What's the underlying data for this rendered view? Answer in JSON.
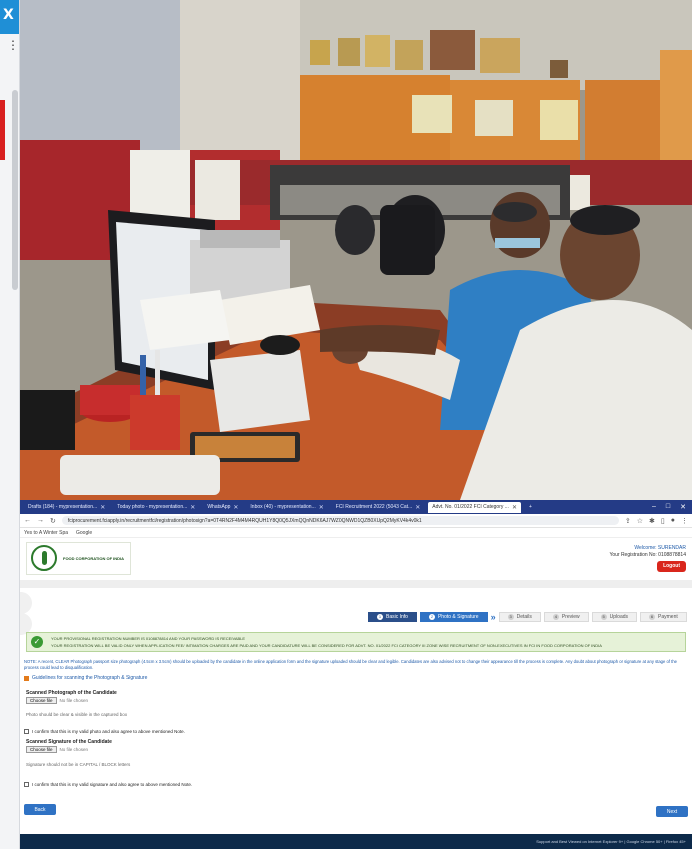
{
  "left_panel": {
    "close_glyph": "X",
    "menu_glyph": "⋮"
  },
  "photo": {
    "description_icon": "photo-image"
  },
  "browser": {
    "tabs": [
      {
        "label": "Drafts (184) - mypresentation...",
        "active": false
      },
      {
        "label": "Today photo - mypresentation...",
        "active": false
      },
      {
        "label": "WhatsApp",
        "active": false
      },
      {
        "label": "Inbox (40) - mypresentation...",
        "active": false
      },
      {
        "label": "FCI Recruitment 2022 (5043 Cat...",
        "active": false
      },
      {
        "label": "Advt. No. 01/2022 FCI Category ...",
        "active": true
      }
    ],
    "new_tab": "+",
    "window_controls": [
      "–",
      "□",
      "✕"
    ],
    "url": "fciprocurement.fciapply.in/recruitmentfci/registration/photosign?a=0T4RN2F4M4M4RQUH1Y8Q0Q5JXmQQnNDK6AJ7WZ0QNWD1QZB0XUpQ2MyKV4k4v0k1",
    "bookmarks": [
      "Yes to A Winter Spa",
      "Google"
    ],
    "header": {
      "logo_text": "FOOD CORPORATION OF INDIA",
      "welcome": "Welcome: SURENDAR",
      "registration": "Your Registration No: 0108878814",
      "logout": "Logout"
    },
    "steps": [
      {
        "num": "1",
        "label": "Basic Info",
        "state": "done"
      },
      {
        "num": "2",
        "label": "Photo & Signature",
        "state": "active"
      },
      {
        "num": "3",
        "label": "Details",
        "state": "todo"
      },
      {
        "num": "4",
        "label": "Preview",
        "state": "todo"
      },
      {
        "num": "5",
        "label": "Uploads",
        "state": "todo"
      },
      {
        "num": "6",
        "label": "Payment",
        "state": "todo"
      }
    ],
    "success": {
      "line1": "YOUR PROVISIONAL REGISTRATION NUMBER IS 0108878814 AND YOUR PASSWORD IS RECEIVABLE",
      "line2": "YOUR REGISTRATION WILL BE VALID ONLY WHEN APPLICATION FEE/ INTIMATION CHARGES ARE PAID AND YOUR CANDIDATURE WILL BE CONSIDERED FOR ADVT. NO. 01/2022 FCI CATEGORY III ZONE WISE RECRUITMENT OF NON-EXECUTIVES IN FCI IN FOOD CORPORATION OF INDIA"
    },
    "note": "NOTE: A recent, CLEAR Photograph passport size photograph (4.5cm x 3.5cm) should be uploaded by the candidate in the online application form and the signature uploaded should be clear and legible. Candidates are also advised not to change their appearance till the process is complete. Any doubt about photograph or signature at any stage of the process could lead to disqualification.",
    "guidelines_link": "Guidelines for scanning the Photograph & Signature",
    "photo_field": {
      "label": "Scanned Photograph of the Candidate",
      "button": "Choose file",
      "status": "No file chosen",
      "hint": "Photo should be clear & visible in the captured box"
    },
    "photo_confirm": "I confirm that this is my valid photo and also agree to above mentioned Note.",
    "signature_field": {
      "label": "Scanned Signature of the Candidate",
      "button": "Choose file",
      "status": "No file chosen",
      "hint": "Signature should not be in CAPITAL / BLOCK letters"
    },
    "signature_confirm": "I confirm that this is my valid signature and also agree to above mentioned Note.",
    "back": "Back",
    "next": "Next",
    "footer": "Support and Best Viewed on Internet Explorer 9+ | Google Chrome 50+ | Firefox 45+"
  }
}
